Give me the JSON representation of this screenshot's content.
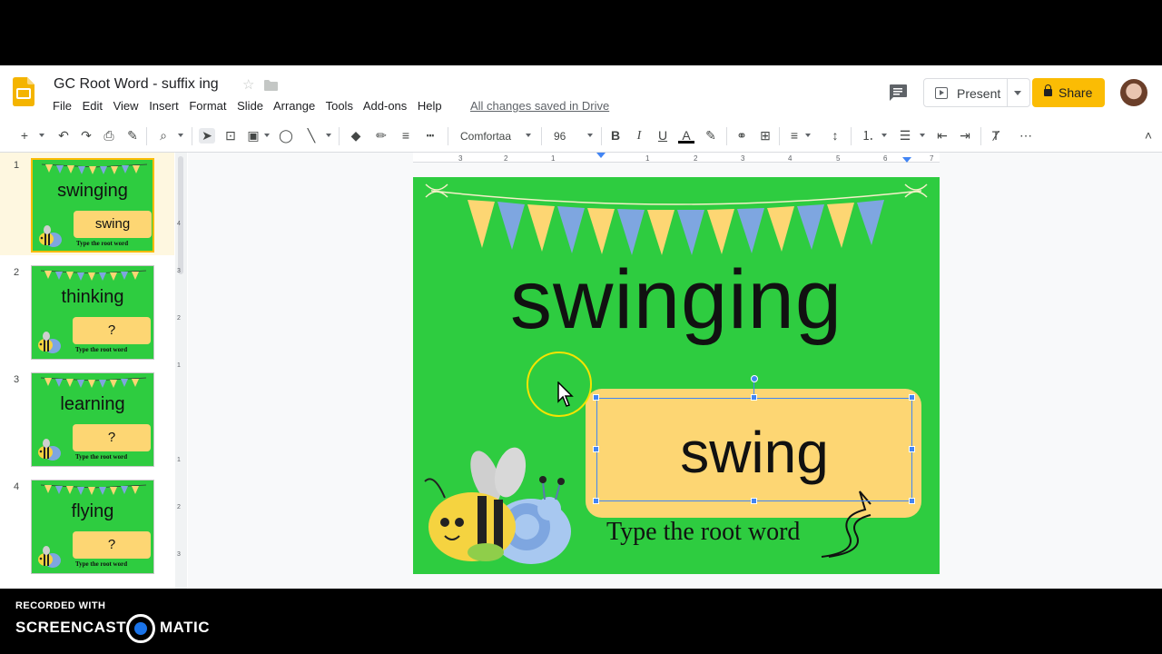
{
  "app": {
    "title": "GC Root Word - suffix ing",
    "saved_status": "All changes saved in Drive",
    "menu": [
      "File",
      "Edit",
      "View",
      "Insert",
      "Format",
      "Slide",
      "Arrange",
      "Tools",
      "Add-ons",
      "Help"
    ],
    "present_label": "Present",
    "share_label": "Share"
  },
  "toolbar": {
    "font_name": "Comfortaa",
    "font_size": "96"
  },
  "slides": [
    {
      "num": "1",
      "word": "swinging",
      "root": "swing",
      "caption": "Type the root word"
    },
    {
      "num": "2",
      "word": "thinking",
      "root": "?",
      "caption": "Type the root word"
    },
    {
      "num": "3",
      "word": "learning",
      "root": "?",
      "caption": "Type the root word"
    },
    {
      "num": "4",
      "word": "flying",
      "root": "?",
      "caption": "Type the root word"
    }
  ],
  "current_slide": {
    "word": "swinging",
    "root": "swing",
    "caption": "Type the root word"
  },
  "ruler": {
    "h_ticks": [
      "3",
      "2",
      "1",
      "1",
      "2",
      "3",
      "4",
      "5",
      "6",
      "7"
    ],
    "v_ticks": [
      "4",
      "3",
      "2",
      "1",
      "1",
      "2",
      "3"
    ]
  },
  "watermark": {
    "recorded_with": "RECORDED WITH",
    "brand_left": "SCREENCAST",
    "brand_right": "MATIC"
  },
  "colors": {
    "slide_bg": "#2ecc40",
    "answer_box": "#fdd673",
    "share": "#fbbc04",
    "selection": "#4285f4"
  }
}
